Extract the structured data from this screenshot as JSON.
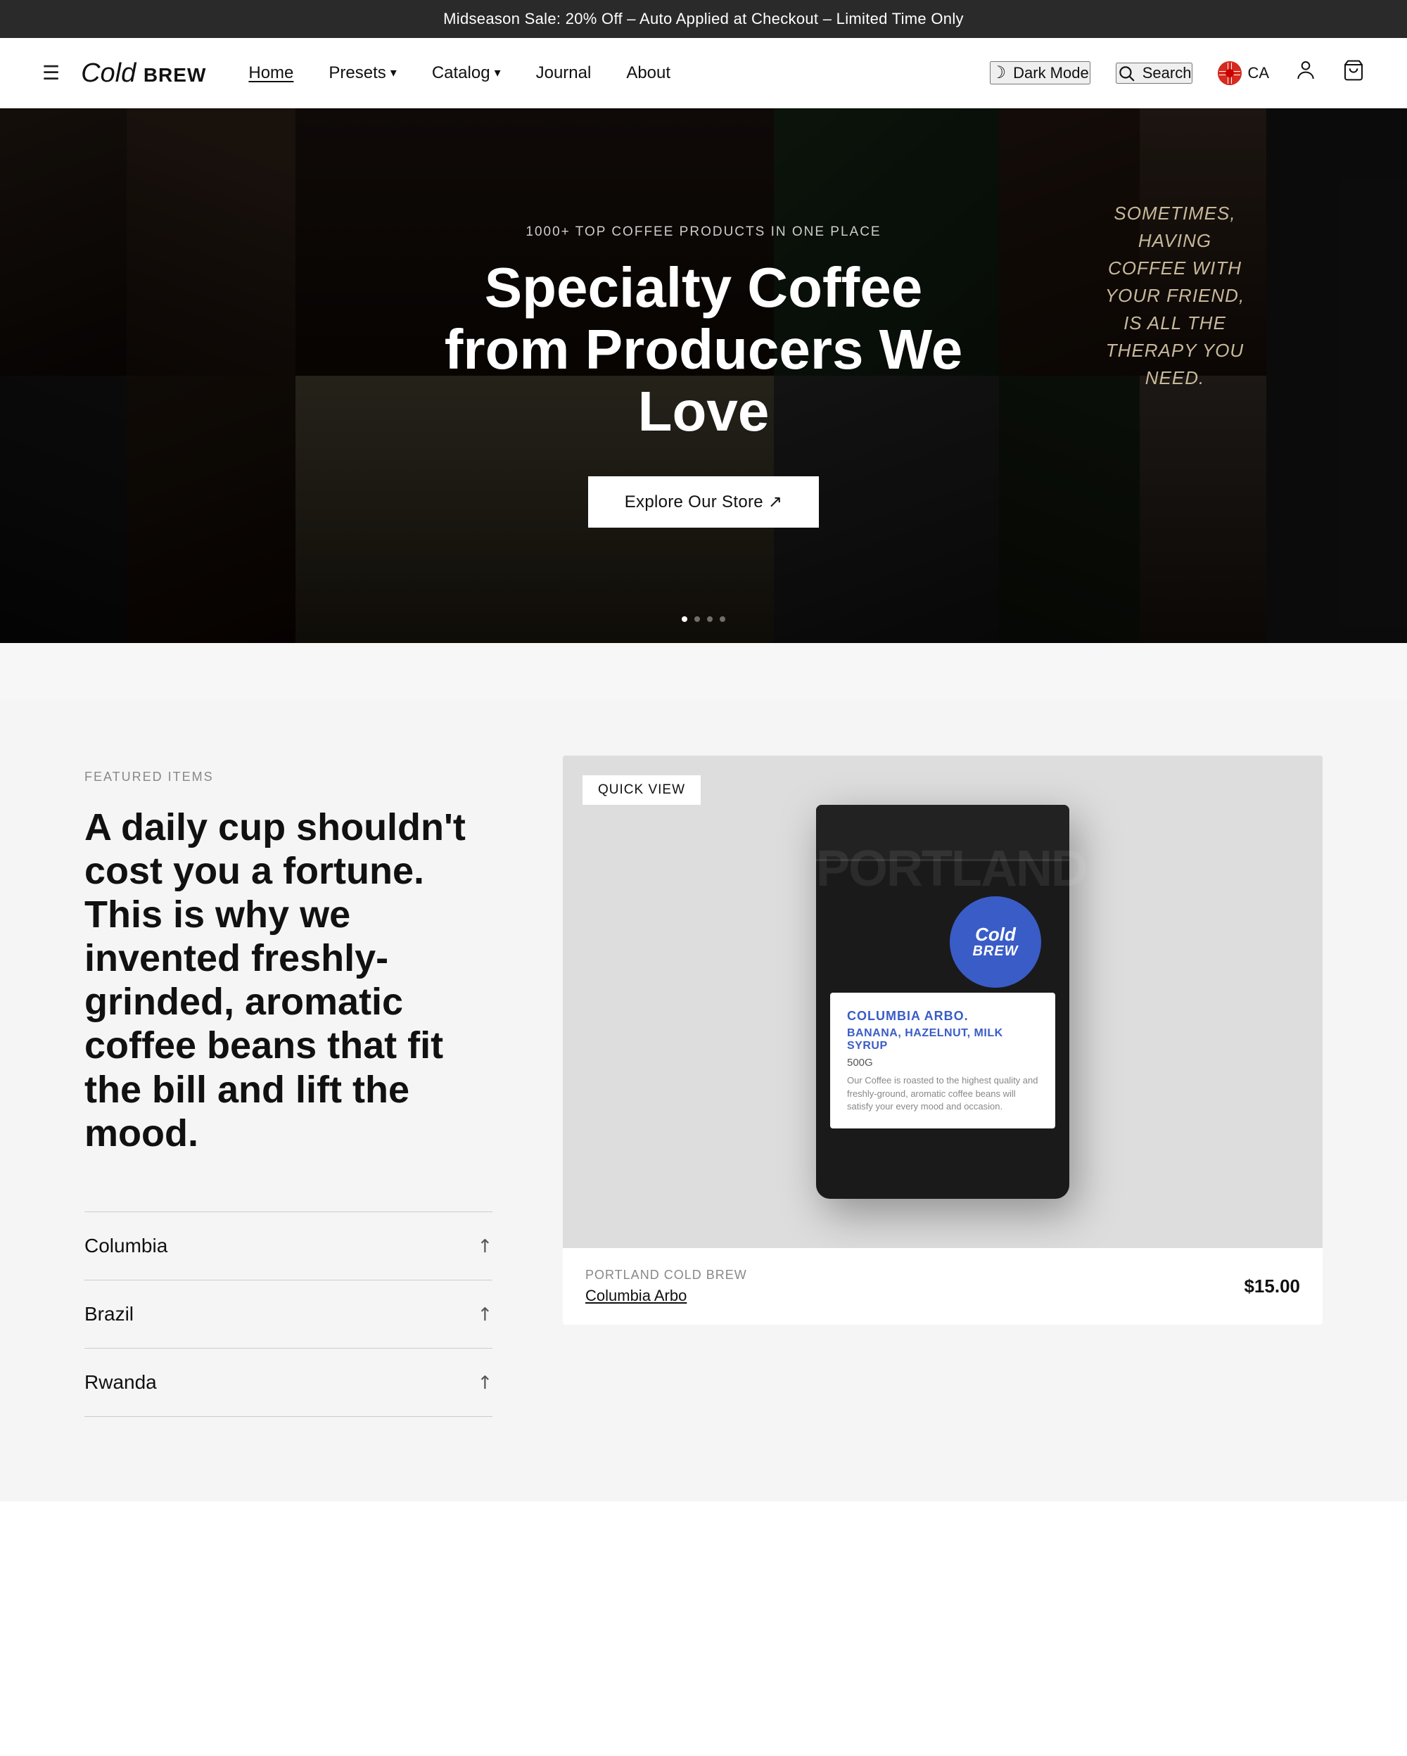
{
  "announcement": {
    "text": "Midseason Sale: 20% Off – Auto Applied at Checkout – Limited Time Only"
  },
  "header": {
    "logo": {
      "italic_part": "Cold",
      "bold_part": "BREW"
    },
    "nav": [
      {
        "label": "Home",
        "active": true,
        "has_dropdown": false
      },
      {
        "label": "Presets",
        "active": false,
        "has_dropdown": true
      },
      {
        "label": "Catalog",
        "active": false,
        "has_dropdown": true
      },
      {
        "label": "Journal",
        "active": false,
        "has_dropdown": false
      },
      {
        "label": "About",
        "active": false,
        "has_dropdown": false
      }
    ],
    "dark_mode_label": "Dark Mode",
    "search_label": "Search",
    "locale": "CA",
    "menu_icon": "☰"
  },
  "hero": {
    "eyebrow": "1000+ TOP COFFEE PRODUCTS IN ONE PLACE",
    "title": "Specialty Coffee from Producers We Love",
    "cta_label": "Explore Our Store ↗",
    "quote": "SOMETIMES, HAVING COFFEE WITH YOUR FRIEND, IS ALL THE THERAPY YOU NEED.",
    "dots": [
      true,
      false,
      false,
      false
    ]
  },
  "featured": {
    "tag": "FEATURED ITEMS",
    "headline": "A daily cup shouldn't cost you a fortune. This is why we invented freshly-grinded, aromatic coffee beans that fit the bill and lift the mood.",
    "list_items": [
      {
        "label": "Columbia"
      },
      {
        "label": "Brazil"
      },
      {
        "label": "Rwanda"
      }
    ],
    "product": {
      "quick_view_label": "QUICK VIEW",
      "bag_brand": "PORTLAND",
      "bag_logo_italic": "Cold",
      "bag_logo_bold": "BREW",
      "label_origin": "COLUMBIA ARBO.",
      "label_desc": "BANANA, HAZELNUT, MILK SYRUP",
      "label_weight": "500G",
      "label_text": "Our Coffee is roasted to the highest quality and freshly-ground, aromatic coffee beans will satisfy your every mood and occasion.",
      "card_name": "PORTLAND COLD BREW",
      "card_variant": "Columbia Arbo",
      "card_price": "$15.00"
    }
  }
}
